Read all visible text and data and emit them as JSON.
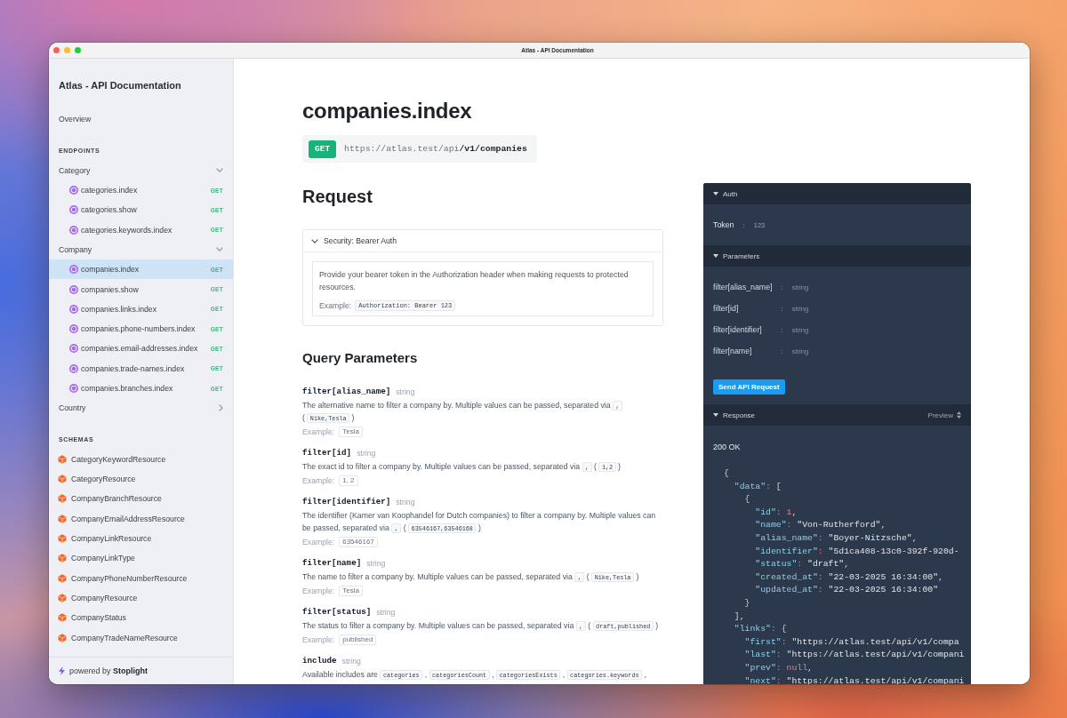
{
  "window": {
    "title": "Atlas - API Documentation"
  },
  "sidebar": {
    "title": "Atlas - API Documentation",
    "overview": {
      "label": "Overview",
      "selected": false
    },
    "endpoints": {
      "heading": "ENDPOINTS",
      "groups": [
        {
          "label": "Category",
          "expanded": true,
          "items": [
            {
              "label": "categories.index",
              "method": "GET",
              "selected": false
            },
            {
              "label": "categories.show",
              "method": "GET",
              "selected": false
            },
            {
              "label": "categories.keywords.index",
              "method": "GET",
              "selected": false
            }
          ]
        },
        {
          "label": "Company",
          "expanded": true,
          "items": [
            {
              "label": "companies.index",
              "method": "GET",
              "selected": true
            },
            {
              "label": "companies.show",
              "method": "GET",
              "selected": false
            },
            {
              "label": "companies.links.index",
              "method": "GET",
              "selected": false
            },
            {
              "label": "companies.phone-numbers.index",
              "method": "GET",
              "selected": false
            },
            {
              "label": "companies.email-addresses.index",
              "method": "GET",
              "selected": false
            },
            {
              "label": "companies.trade-names.index",
              "method": "GET",
              "selected": false
            },
            {
              "label": "companies.branches.index",
              "method": "GET",
              "selected": false
            }
          ]
        },
        {
          "label": "Country",
          "expanded": false
        }
      ]
    },
    "schemas": {
      "heading": "SCHEMAS",
      "items": [
        {
          "label": "CategoryKeywordResource",
          "selected": false
        },
        {
          "label": "CategoryResource",
          "selected": false
        },
        {
          "label": "CompanyBranchResource",
          "selected": false
        },
        {
          "label": "CompanyEmailAddressResource",
          "selected": false
        },
        {
          "label": "CompanyLinkResource",
          "selected": false
        },
        {
          "label": "CompanyLinkType",
          "selected": false
        },
        {
          "label": "CompanyPhoneNumberResource",
          "selected": false
        },
        {
          "label": "CompanyResource",
          "selected": false
        },
        {
          "label": "CompanyStatus",
          "selected": false
        },
        {
          "label": "CompanyTradeNameResource",
          "selected": false
        }
      ]
    },
    "footer": "powered by **Stoplight**"
  },
  "endpoint": {
    "title": "companies.index",
    "method": "GET",
    "base_url": "https://atlas.test/api",
    "path": "/v1/companies"
  },
  "request": {
    "heading": "Request",
    "security": {
      "title": "Security: Bearer Auth",
      "expanded": true,
      "description": "Provide your bearer token in the Authorization header when making requests to protected resources.",
      "example_label": "Example:",
      "example": "Authorization: Bearer 123"
    }
  },
  "query_parameters": {
    "heading": "Query Parameters",
    "params": [
      {
        "name": "filter[alias_name]",
        "type": "string",
        "description": [
          {
            "kind": "text",
            "text": "The alternative name to filter a company by. Multiple values can be passed, separated via"
          },
          {
            "kind": "code",
            "text": ","
          },
          {
            "kind": "text",
            "text": "("
          },
          {
            "kind": "code",
            "text": "Nike,Tesla"
          },
          {
            "kind": "text",
            "text": ")"
          }
        ],
        "example_label": "Example:",
        "example": "Tesla"
      },
      {
        "name": "filter[id]",
        "type": "string",
        "description": [
          {
            "kind": "text",
            "text": "The exact id to filter a company by. Multiple values can be passed, separated via"
          },
          {
            "kind": "code",
            "text": ","
          },
          {
            "kind": "text",
            "text": "("
          },
          {
            "kind": "code",
            "text": "1,2"
          },
          {
            "kind": "text",
            "text": ")"
          }
        ],
        "example_label": "Example:",
        "example": "1, 2"
      },
      {
        "name": "filter[identifier]",
        "type": "string",
        "description": [
          {
            "kind": "text",
            "text": "The identifier (Kamer van Koophandel for Dutch companies) to filter a company by. Multiple values can be passed, separated via"
          },
          {
            "kind": "code",
            "text": ","
          },
          {
            "kind": "text",
            "text": "("
          },
          {
            "kind": "code",
            "text": "63546167,63546168"
          },
          {
            "kind": "text",
            "text": ")"
          }
        ],
        "example_label": "Example:",
        "example": "63546167"
      },
      {
        "name": "filter[name]",
        "type": "string",
        "description": [
          {
            "kind": "text",
            "text": "The name to filter a company by. Multiple values can be passed, separated via"
          },
          {
            "kind": "code",
            "text": ","
          },
          {
            "kind": "text",
            "text": "("
          },
          {
            "kind": "code",
            "text": "Nike,Tesla"
          },
          {
            "kind": "text",
            "text": ")"
          }
        ],
        "example_label": "Example:",
        "example": "Tesla"
      },
      {
        "name": "filter[status]",
        "type": "string",
        "description": [
          {
            "kind": "text",
            "text": "The status to filter a company by. Multiple values can be passed, separated via"
          },
          {
            "kind": "code",
            "text": ","
          },
          {
            "kind": "text",
            "text": "("
          },
          {
            "kind": "code",
            "text": "draft,published"
          },
          {
            "kind": "text",
            "text": ")"
          }
        ],
        "example_label": "Example:",
        "example": "published"
      },
      {
        "name": "include",
        "type": "string",
        "description": [
          {
            "kind": "text",
            "text": "Available includes are"
          },
          {
            "kind": "code",
            "text": "categories"
          },
          {
            "kind": "text",
            "text": ","
          },
          {
            "kind": "code",
            "text": "categoriesCount"
          },
          {
            "kind": "text",
            "text": ","
          },
          {
            "kind": "code",
            "text": "categoriesExists"
          },
          {
            "kind": "text",
            "text": ","
          },
          {
            "kind": "code",
            "text": "categories.keywords"
          },
          {
            "kind": "text",
            "text": ","
          }
        ]
      }
    ]
  },
  "try_it": {
    "sections": [
      {
        "kind": "auth",
        "title": "Auth",
        "expanded": true,
        "fields": [
          {
            "label": "Token",
            "separator": ":",
            "value": "123"
          }
        ]
      },
      {
        "kind": "parameters",
        "title": "Parameters",
        "expanded": true,
        "fields": [
          {
            "label": "filter[alias_name]",
            "separator": ":",
            "placeholder": "string"
          },
          {
            "label": "filter[id]",
            "separator": ":",
            "placeholder": "string"
          },
          {
            "label": "filter[identifier]",
            "separator": ":",
            "placeholder": "string"
          },
          {
            "label": "filter[name]",
            "separator": ":",
            "placeholder": "string"
          }
        ],
        "button": "Send API Request"
      },
      {
        "kind": "response",
        "title": "Response",
        "expanded": true,
        "view": "Preview",
        "status": "200 OK",
        "lines": [
          {
            "tokens": [
              {
                "kind": "punct",
                "text": "{"
              }
            ]
          },
          {
            "tokens": [
              {
                "kind": "key",
                "text": "  \"data\""
              },
              {
                "kind": "colon",
                "text": ":"
              },
              {
                "kind": "punct",
                "text": " ["
              }
            ]
          },
          {
            "tokens": [
              {
                "kind": "punct",
                "text": "    {"
              }
            ]
          },
          {
            "tokens": [
              {
                "kind": "key",
                "text": "      \"id\""
              },
              {
                "kind": "colon",
                "text": ":"
              },
              {
                "kind": "number",
                "text": " 1"
              },
              {
                "kind": "punct",
                "text": ","
              }
            ]
          },
          {
            "tokens": [
              {
                "kind": "key",
                "text": "      \"name\""
              },
              {
                "kind": "colon",
                "text": ":"
              },
              {
                "kind": "string",
                "text": " \"Von-Rutherford\""
              },
              {
                "kind": "punct",
                "text": ","
              }
            ]
          },
          {
            "tokens": [
              {
                "kind": "key",
                "text": "      \"alias_name\""
              },
              {
                "kind": "colon",
                "text": ":"
              },
              {
                "kind": "string",
                "text": " \"Boyer-Nitzsche\""
              },
              {
                "kind": "punct",
                "text": ","
              }
            ]
          },
          {
            "tokens": [
              {
                "kind": "key",
                "text": "      \"identifier\""
              },
              {
                "kind": "colon",
                "text": ":"
              },
              {
                "kind": "string",
                "text": " \"5d1ca408-13c0-392f-920d-"
              }
            ]
          },
          {
            "tokens": [
              {
                "kind": "key",
                "text": "      \"status\""
              },
              {
                "kind": "colon",
                "text": ":"
              },
              {
                "kind": "string",
                "text": " \"draft\""
              },
              {
                "kind": "punct",
                "text": ","
              }
            ]
          },
          {
            "tokens": [
              {
                "kind": "key",
                "text": "      \"created_at\""
              },
              {
                "kind": "colon",
                "text": ":"
              },
              {
                "kind": "string",
                "text": " \"22-03-2025 16:34:00\""
              },
              {
                "kind": "punct",
                "text": ","
              }
            ]
          },
          {
            "tokens": [
              {
                "kind": "key",
                "text": "      \"updated_at\""
              },
              {
                "kind": "colon",
                "text": ":"
              },
              {
                "kind": "string",
                "text": " \"22-03-2025 16:34:00\""
              }
            ]
          },
          {
            "tokens": [
              {
                "kind": "punct",
                "text": "    }"
              }
            ]
          },
          {
            "tokens": [
              {
                "kind": "punct",
                "text": "  ],"
              }
            ]
          },
          {
            "tokens": [
              {
                "kind": "key",
                "text": "  \"links\""
              },
              {
                "kind": "colon",
                "text": ":"
              },
              {
                "kind": "punct",
                "text": " {"
              }
            ]
          },
          {
            "tokens": [
              {
                "kind": "key",
                "text": "    \"first\""
              },
              {
                "kind": "colon",
                "text": ":"
              },
              {
                "kind": "string",
                "text": " \"https://atlas.test/api/v1/compa"
              }
            ]
          },
          {
            "tokens": [
              {
                "kind": "key",
                "text": "    \"last\""
              },
              {
                "kind": "colon",
                "text": ":"
              },
              {
                "kind": "string",
                "text": " \"https://atlas.test/api/v1/compani"
              }
            ]
          },
          {
            "tokens": [
              {
                "kind": "key",
                "text": "    \"prev\""
              },
              {
                "kind": "colon",
                "text": ":"
              },
              {
                "kind": "null",
                "text": " null"
              },
              {
                "kind": "punct",
                "text": ","
              }
            ]
          },
          {
            "tokens": [
              {
                "kind": "key",
                "text": "    \"next\""
              },
              {
                "kind": "colon",
                "text": ":"
              },
              {
                "kind": "string",
                "text": " \"https://atlas.test/api/v1/compani"
              }
            ]
          }
        ]
      }
    ]
  }
}
